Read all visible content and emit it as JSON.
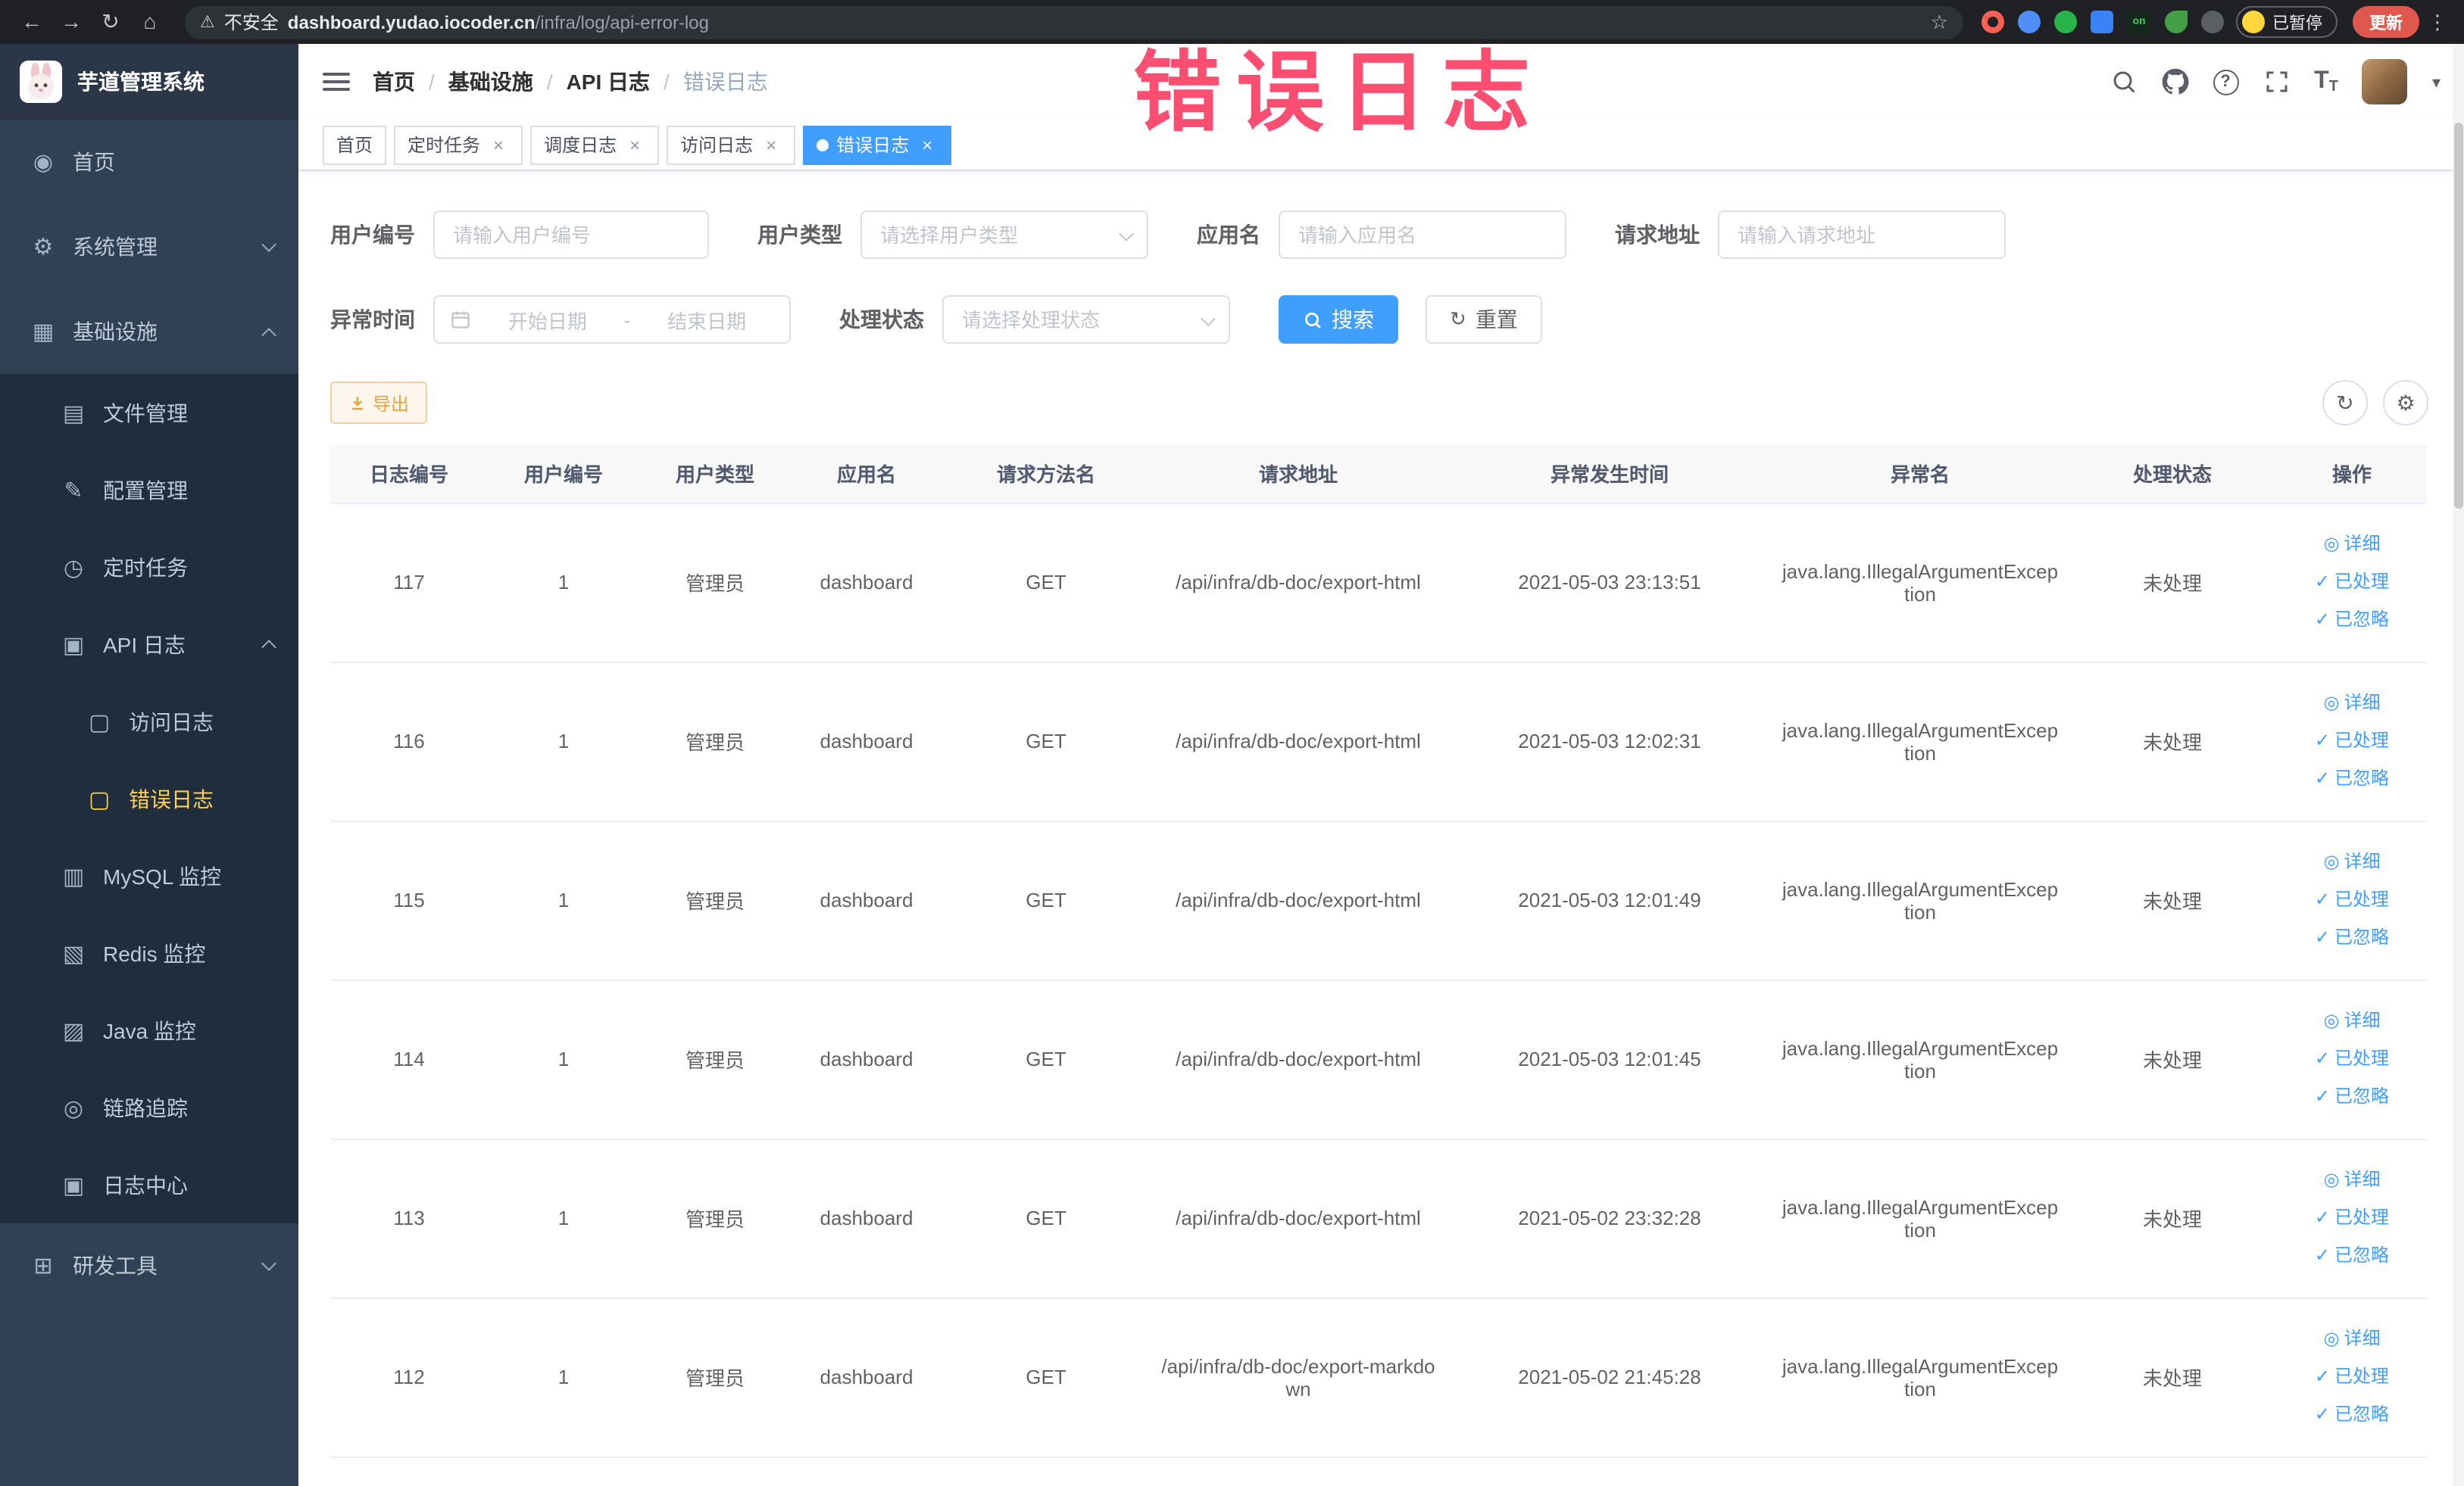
{
  "annotation": {
    "text": "错误日志"
  },
  "browser": {
    "security_label": "不安全",
    "url_domain": "dashboard.yudao.iocoder.cn",
    "url_path": "/infra/log/api-error-log",
    "extension_on_badge": "on",
    "paused_badge": "已暂停",
    "update_button": "更新"
  },
  "icons": {
    "back": "←",
    "forward": "→",
    "reload": "↻",
    "home": "⌂",
    "warning": "⚠",
    "star": "☆",
    "kebab": "⋮",
    "question": "?",
    "font_size_big": "T",
    "font_size_small": "T",
    "caret_down": "▾",
    "close": "×",
    "check": "✓",
    "detail_eye": "◎",
    "refresh": "↻",
    "columns_setting": "⚙",
    "menu_home": "◉",
    "menu_system": "⚙",
    "menu_infra": "▦",
    "menu_file": "▤",
    "menu_config": "✎",
    "menu_task": "◷",
    "menu_apilog": "▣",
    "menu_access": "▢",
    "menu_error": "▢",
    "menu_mysql": "▥",
    "menu_redis": "▧",
    "menu_java": "▨",
    "menu_trace": "◎",
    "menu_logcenter": "▣",
    "menu_tools": "⊞"
  },
  "sidebar": {
    "logo_title": "芋道管理系统",
    "menu": [
      {
        "label": "首页"
      },
      {
        "label": "系统管理"
      },
      {
        "label": "基础设施"
      },
      {
        "label": "文件管理"
      },
      {
        "label": "配置管理"
      },
      {
        "label": "定时任务"
      },
      {
        "label": "API 日志"
      },
      {
        "label": "访问日志"
      },
      {
        "label": "错误日志"
      },
      {
        "label": "MySQL 监控"
      },
      {
        "label": "Redis 监控"
      },
      {
        "label": "Java 监控"
      },
      {
        "label": "链路追踪"
      },
      {
        "label": "日志中心"
      },
      {
        "label": "研发工具"
      }
    ]
  },
  "header": {
    "breadcrumb": [
      "首页",
      "基础设施",
      "API 日志",
      "错误日志"
    ],
    "breadcrumb_separator": "/"
  },
  "tabs": [
    {
      "label": "首页"
    },
    {
      "label": "定时任务"
    },
    {
      "label": "调度日志"
    },
    {
      "label": "访问日志"
    },
    {
      "label": "错误日志"
    }
  ],
  "filters": {
    "user_id": {
      "label": "用户编号",
      "placeholder": "请输入用户编号"
    },
    "user_type": {
      "label": "用户类型",
      "placeholder": "请选择用户类型"
    },
    "app_name": {
      "label": "应用名",
      "placeholder": "请输入应用名"
    },
    "request_url": {
      "label": "请求地址",
      "placeholder": "请输入请求地址"
    },
    "exception_time": {
      "label": "异常时间",
      "start_placeholder": "开始日期",
      "separator": "-",
      "end_placeholder": "结束日期"
    },
    "process_status": {
      "label": "处理状态",
      "placeholder": "请选择处理状态"
    },
    "search_button": "搜索",
    "reset_button": "重置"
  },
  "toolbar": {
    "export_button": "导出"
  },
  "table": {
    "columns": [
      "日志编号",
      "用户编号",
      "用户类型",
      "应用名",
      "请求方法名",
      "请求地址",
      "异常发生时间",
      "异常名",
      "处理状态",
      "操作"
    ],
    "action_labels": {
      "detail": "详细",
      "processed": "已处理",
      "ignored": "已忽略"
    },
    "rows": [
      {
        "id": "117",
        "user_id": "1",
        "user_type": "管理员",
        "app": "dashboard",
        "method": "GET",
        "url": "/api/infra/db-doc/export-html",
        "time": "2021-05-03 23:13:51",
        "exception": "java.lang.IllegalArgumentException",
        "status": "未处理"
      },
      {
        "id": "116",
        "user_id": "1",
        "user_type": "管理员",
        "app": "dashboard",
        "method": "GET",
        "url": "/api/infra/db-doc/export-html",
        "time": "2021-05-03 12:02:31",
        "exception": "java.lang.IllegalArgumentException",
        "status": "未处理"
      },
      {
        "id": "115",
        "user_id": "1",
        "user_type": "管理员",
        "app": "dashboard",
        "method": "GET",
        "url": "/api/infra/db-doc/export-html",
        "time": "2021-05-03 12:01:49",
        "exception": "java.lang.IllegalArgumentException",
        "status": "未处理"
      },
      {
        "id": "114",
        "user_id": "1",
        "user_type": "管理员",
        "app": "dashboard",
        "method": "GET",
        "url": "/api/infra/db-doc/export-html",
        "time": "2021-05-03 12:01:45",
        "exception": "java.lang.IllegalArgumentException",
        "status": "未处理"
      },
      {
        "id": "113",
        "user_id": "1",
        "user_type": "管理员",
        "app": "dashboard",
        "method": "GET",
        "url": "/api/infra/db-doc/export-html",
        "time": "2021-05-02 23:32:28",
        "exception": "java.lang.IllegalArgumentException",
        "status": "未处理"
      },
      {
        "id": "112",
        "user_id": "1",
        "user_type": "管理员",
        "app": "dashboard",
        "method": "GET",
        "url": "/api/infra/db-doc/export-markdown",
        "time": "2021-05-02 21:45:28",
        "exception": "java.lang.IllegalArgumentException",
        "status": "未处理"
      }
    ]
  },
  "colors": {
    "accent_blue": "#409eff",
    "sidebar_bg": "#304156",
    "submenu_bg": "#1f2d3d",
    "active_menu_yellow": "#ffd04b",
    "warning_orange": "#e6a23c",
    "annotation_pink": "#fb3f66",
    "chrome_dark": "#202124"
  }
}
